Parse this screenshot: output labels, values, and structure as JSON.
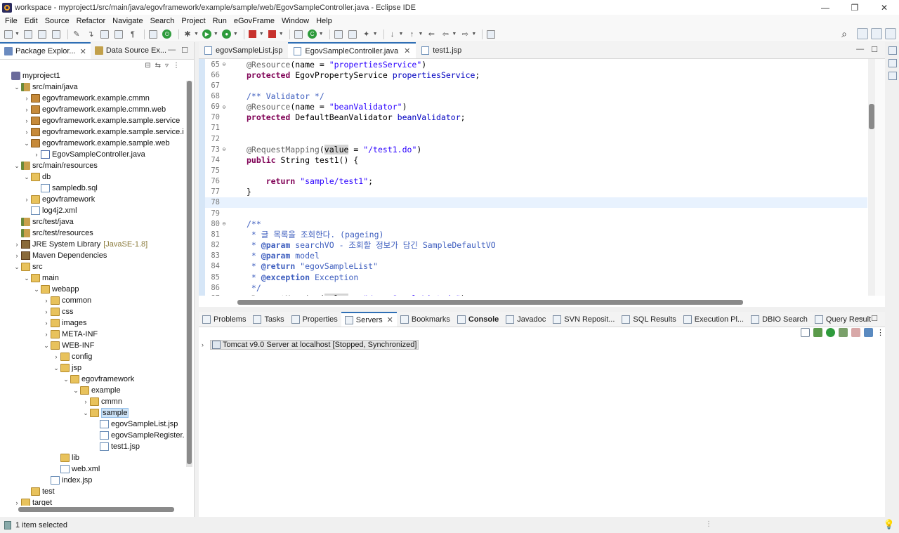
{
  "window": {
    "title": "workspace - myproject1/src/main/java/egovframework/example/sample/web/EgovSampleController.java - Eclipse IDE",
    "minimize": "—",
    "restore": "❐",
    "close": "✕"
  },
  "menu": [
    "File",
    "Edit",
    "Source",
    "Refactor",
    "Navigate",
    "Search",
    "Project",
    "Run",
    "eGovFrame",
    "Window",
    "Help"
  ],
  "left_panel": {
    "tabs": [
      {
        "label": "Package Explor...",
        "active": true
      },
      {
        "label": "Data Source Ex...",
        "active": false
      }
    ],
    "tree": [
      {
        "label": "myproject1",
        "depth": 0,
        "chev": "",
        "icon": "project"
      },
      {
        "label": "src/main/java",
        "depth": 1,
        "chev": "open",
        "icon": "srcfolder"
      },
      {
        "label": "egovframework.example.cmmn",
        "depth": 2,
        "chev": "closed",
        "icon": "pkg"
      },
      {
        "label": "egovframework.example.cmmn.web",
        "depth": 2,
        "chev": "closed",
        "icon": "pkg"
      },
      {
        "label": "egovframework.example.sample.service",
        "depth": 2,
        "chev": "closed",
        "icon": "pkg"
      },
      {
        "label": "egovframework.example.sample.service.impl",
        "depth": 2,
        "chev": "closed",
        "icon": "pkg"
      },
      {
        "label": "egovframework.example.sample.web",
        "depth": 2,
        "chev": "open",
        "icon": "pkg"
      },
      {
        "label": "EgovSampleController.java",
        "depth": 3,
        "chev": "closed",
        "icon": "javafile"
      },
      {
        "label": "src/main/resources",
        "depth": 1,
        "chev": "open",
        "icon": "srcfolder"
      },
      {
        "label": "db",
        "depth": 2,
        "chev": "open",
        "icon": "folder"
      },
      {
        "label": "sampledb.sql",
        "depth": 3,
        "chev": "",
        "icon": "file"
      },
      {
        "label": "egovframework",
        "depth": 2,
        "chev": "closed",
        "icon": "folder"
      },
      {
        "label": "log4j2.xml",
        "depth": 2,
        "chev": "",
        "icon": "file"
      },
      {
        "label": "src/test/java",
        "depth": 1,
        "chev": "",
        "icon": "srcfolder"
      },
      {
        "label": "src/test/resources",
        "depth": 1,
        "chev": "",
        "icon": "srcfolder"
      },
      {
        "label": "JRE System Library",
        "depth": 1,
        "chev": "closed",
        "icon": "lib",
        "deco": "[JavaSE-1.8]"
      },
      {
        "label": "Maven Dependencies",
        "depth": 1,
        "chev": "closed",
        "icon": "lib"
      },
      {
        "label": "src",
        "depth": 1,
        "chev": "open",
        "icon": "folder"
      },
      {
        "label": "main",
        "depth": 2,
        "chev": "open",
        "icon": "folder"
      },
      {
        "label": "webapp",
        "depth": 3,
        "chev": "open",
        "icon": "folder"
      },
      {
        "label": "common",
        "depth": 4,
        "chev": "closed",
        "icon": "folder"
      },
      {
        "label": "css",
        "depth": 4,
        "chev": "closed",
        "icon": "folder"
      },
      {
        "label": "images",
        "depth": 4,
        "chev": "closed",
        "icon": "folder"
      },
      {
        "label": "META-INF",
        "depth": 4,
        "chev": "closed",
        "icon": "folder"
      },
      {
        "label": "WEB-INF",
        "depth": 4,
        "chev": "open",
        "icon": "folder"
      },
      {
        "label": "config",
        "depth": 5,
        "chev": "closed",
        "icon": "folder"
      },
      {
        "label": "jsp",
        "depth": 5,
        "chev": "open",
        "icon": "folder"
      },
      {
        "label": "egovframework",
        "depth": 6,
        "chev": "open",
        "icon": "folder"
      },
      {
        "label": "example",
        "depth": 7,
        "chev": "open",
        "icon": "folder"
      },
      {
        "label": "cmmn",
        "depth": 8,
        "chev": "closed",
        "icon": "folder"
      },
      {
        "label": "sample",
        "depth": 8,
        "chev": "open",
        "icon": "folder",
        "selected": true
      },
      {
        "label": "egovSampleList.jsp",
        "depth": 9,
        "chev": "",
        "icon": "file"
      },
      {
        "label": "egovSampleRegister.jsp",
        "depth": 9,
        "chev": "",
        "icon": "file"
      },
      {
        "label": "test1.jsp",
        "depth": 9,
        "chev": "",
        "icon": "file"
      },
      {
        "label": "lib",
        "depth": 5,
        "chev": "",
        "icon": "folder"
      },
      {
        "label": "web.xml",
        "depth": 5,
        "chev": "",
        "icon": "file"
      },
      {
        "label": "index.jsp",
        "depth": 4,
        "chev": "",
        "icon": "file"
      },
      {
        "label": "test",
        "depth": 2,
        "chev": "",
        "icon": "folder"
      },
      {
        "label": "target",
        "depth": 1,
        "chev": "closed",
        "icon": "folder"
      }
    ]
  },
  "editor": {
    "tabs": [
      {
        "label": "egovSampleList.jsp",
        "active": false
      },
      {
        "label": "EgovSampleController.java",
        "active": true
      },
      {
        "label": "test1.jsp",
        "active": false
      }
    ],
    "lines": [
      {
        "n": "65",
        "fold": true,
        "html": "<span class='ann'>@Resource</span>(name = <span class='str'>\"propertiesService\"</span>)"
      },
      {
        "n": "66",
        "html": "<span class='kw'>protected</span> EgovPropertyService <span class='fld'>propertiesService</span>;"
      },
      {
        "n": "67",
        "html": ""
      },
      {
        "n": "68",
        "html": "<span class='cm'>/** Validator */</span>"
      },
      {
        "n": "69",
        "fold": true,
        "html": "<span class='ann'>@Resource</span>(name = <span class='str'>\"beanValidator\"</span>)"
      },
      {
        "n": "70",
        "html": "<span class='kw'>protected</span> DefaultBeanValidator <span class='fld'>beanValidator</span>;"
      },
      {
        "n": "71",
        "html": ""
      },
      {
        "n": "72",
        "html": ""
      },
      {
        "n": "73",
        "fold": true,
        "html": "<span class='ann'>@RequestMapping</span>(<span class='hl'>value</span> = <span class='str'>\"/test1.do\"</span>)"
      },
      {
        "n": "74",
        "html": "<span class='kw'>public</span> String test1() {"
      },
      {
        "n": "75",
        "html": ""
      },
      {
        "n": "76",
        "html": "    <span class='kw'>return</span> <span class='str'>\"sample/test1\"</span>;"
      },
      {
        "n": "77",
        "html": "}"
      },
      {
        "n": "78",
        "current": true,
        "html": ""
      },
      {
        "n": "79",
        "html": ""
      },
      {
        "n": "80",
        "fold": true,
        "html": "<span class='cm'>/**</span>"
      },
      {
        "n": "81",
        "html": "<span class='cm'> * 글 목록을 조회한다. (pageing)</span>"
      },
      {
        "n": "82",
        "html": "<span class='cm'> * <b>@param</b> searchVO - 조회할 정보가 담긴 SampleDefaultVO</span>"
      },
      {
        "n": "83",
        "html": "<span class='cm'> * <b>@param</b> model</span>"
      },
      {
        "n": "84",
        "html": "<span class='cm'> * <b>@return</b> \"egovSampleList\"</span>"
      },
      {
        "n": "85",
        "html": "<span class='cm'> * <b>@exception</b> Exception</span>"
      },
      {
        "n": "86",
        "html": "<span class='cm'> */</span>"
      },
      {
        "n": "87",
        "fold": true,
        "html": "<span class='ann'>@RequestMapping</span>(<span class='hl'>value</span> = <span class='str'>\"/egovSampleList.do\"</span>)"
      }
    ]
  },
  "bottom_panel": {
    "tabs": [
      {
        "label": "Problems"
      },
      {
        "label": "Tasks"
      },
      {
        "label": "Properties"
      },
      {
        "label": "Servers",
        "active": true,
        "closable": true
      },
      {
        "label": "Bookmarks"
      },
      {
        "label": "Console",
        "bold": true
      },
      {
        "label": "Javadoc"
      },
      {
        "label": "SVN Reposit..."
      },
      {
        "label": "SQL Results"
      },
      {
        "label": "Execution Pl..."
      },
      {
        "label": "DBIO Search"
      },
      {
        "label": "Query Result"
      }
    ],
    "server_entry": "Tomcat v9.0 Server at localhost  [Stopped, Synchronized]"
  },
  "status": {
    "text": "1 item selected"
  }
}
